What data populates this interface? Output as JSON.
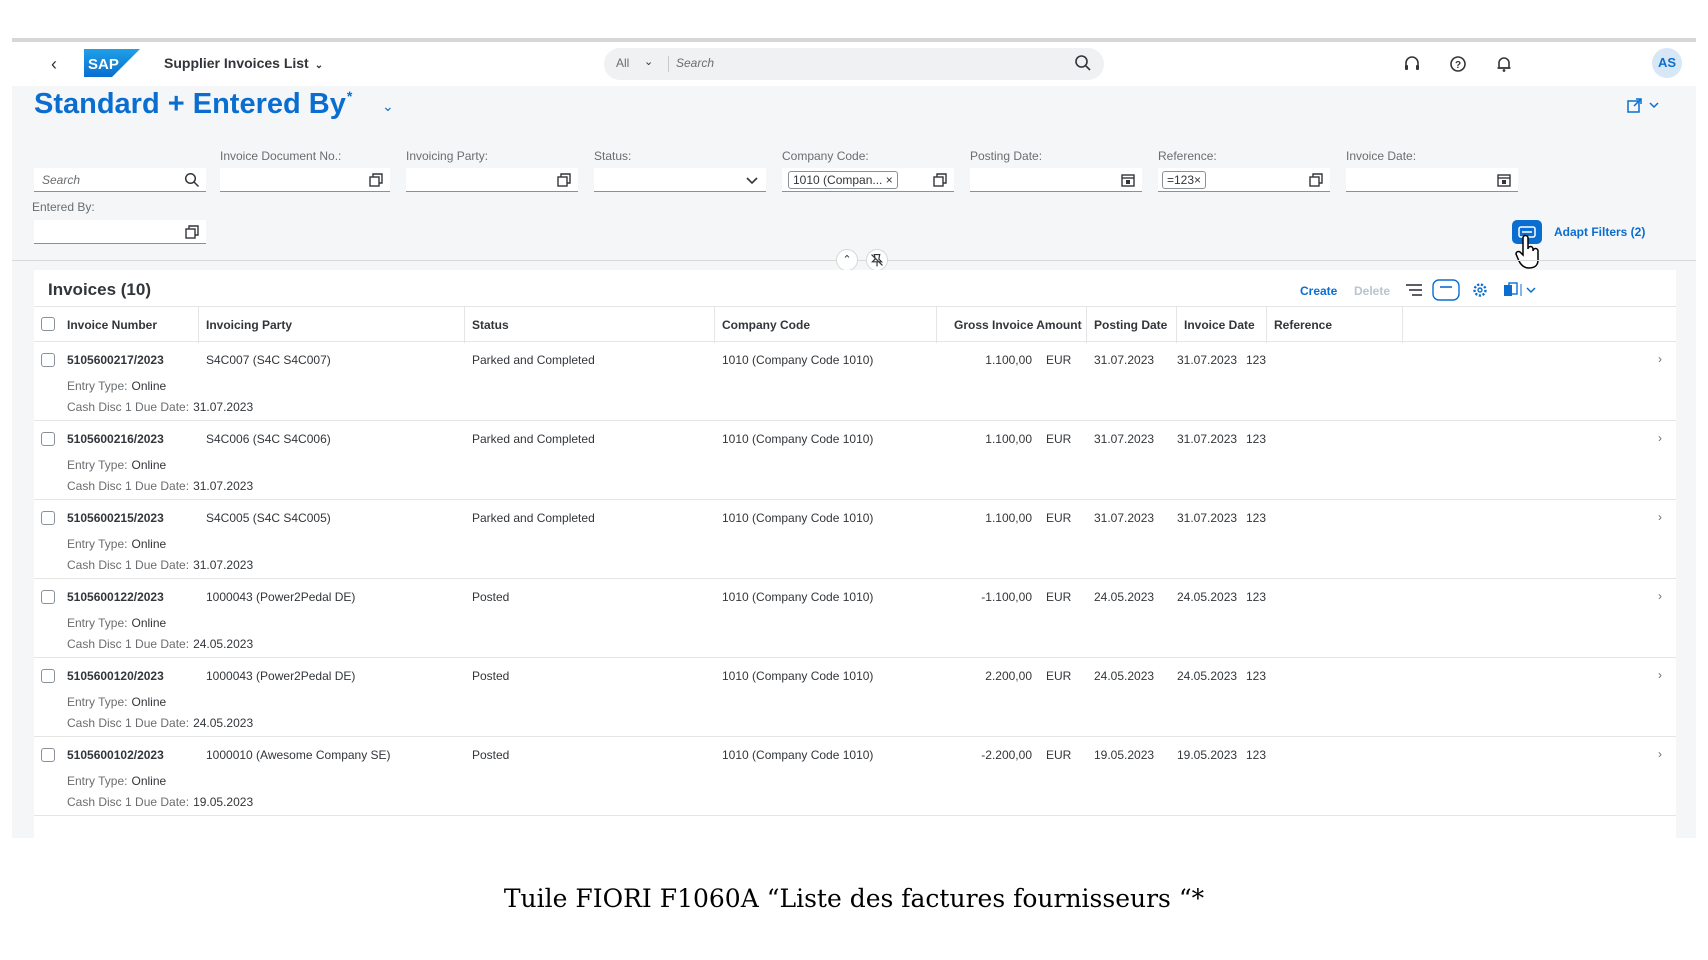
{
  "shell": {
    "app_title": "Supplier Invoices List",
    "search_scope": "All",
    "search_placeholder": "Search",
    "avatar_initials": "AS"
  },
  "header": {
    "variant_name": "Standard + Entered By",
    "variant_modified_marker": "*"
  },
  "filters": {
    "search_placeholder": "Search",
    "invoice_doc_label": "Invoice Document No.:",
    "invoicing_party_label": "Invoicing Party:",
    "status_label": "Status:",
    "company_code_label": "Company Code:",
    "company_code_token": "1010 (Compan...",
    "posting_date_label": "Posting Date:",
    "reference_label": "Reference:",
    "reference_token": "=123",
    "invoice_date_label": "Invoice Date:",
    "entered_by_label": "Entered By:",
    "adapt_filters_label": "Adapt Filters (2)"
  },
  "table": {
    "title": "Invoices (10)",
    "create_label": "Create",
    "delete_label": "Delete",
    "columns": {
      "invoice_number": "Invoice Number",
      "invoicing_party": "Invoicing Party",
      "status": "Status",
      "company_code": "Company Code",
      "gross_amount": "Gross Invoice Amount",
      "posting_date": "Posting Date",
      "invoice_date": "Invoice Date",
      "reference": "Reference"
    },
    "entry_type_label": "Entry Type:",
    "cash_disc_label": "Cash Disc 1 Due Date:",
    "rows": [
      {
        "invoice": "5105600217/2023",
        "party": "S4C007 (S4C S4C007)",
        "status": "Parked and Completed",
        "company": "1010 (Company Code 1010)",
        "amount": "1.100,00",
        "currency": "EUR",
        "posting": "31.07.2023",
        "invoice_date": "31.07.2023",
        "reference": "123",
        "entry_type": "Online",
        "cash_disc": "31.07.2023"
      },
      {
        "invoice": "5105600216/2023",
        "party": "S4C006 (S4C S4C006)",
        "status": "Parked and Completed",
        "company": "1010 (Company Code 1010)",
        "amount": "1.100,00",
        "currency": "EUR",
        "posting": "31.07.2023",
        "invoice_date": "31.07.2023",
        "reference": "123",
        "entry_type": "Online",
        "cash_disc": "31.07.2023"
      },
      {
        "invoice": "5105600215/2023",
        "party": "S4C005 (S4C S4C005)",
        "status": "Parked and Completed",
        "company": "1010 (Company Code 1010)",
        "amount": "1.100,00",
        "currency": "EUR",
        "posting": "31.07.2023",
        "invoice_date": "31.07.2023",
        "reference": "123",
        "entry_type": "Online",
        "cash_disc": "31.07.2023"
      },
      {
        "invoice": "5105600122/2023",
        "party": "1000043 (Power2Pedal DE)",
        "status": "Posted",
        "company": "1010 (Company Code 1010)",
        "amount": "-1.100,00",
        "currency": "EUR",
        "posting": "24.05.2023",
        "invoice_date": "24.05.2023",
        "reference": "123",
        "entry_type": "Online",
        "cash_disc": "24.05.2023"
      },
      {
        "invoice": "5105600120/2023",
        "party": "1000043 (Power2Pedal DE)",
        "status": "Posted",
        "company": "1010 (Company Code 1010)",
        "amount": "2.200,00",
        "currency": "EUR",
        "posting": "24.05.2023",
        "invoice_date": "24.05.2023",
        "reference": "123",
        "entry_type": "Online",
        "cash_disc": "24.05.2023"
      },
      {
        "invoice": "5105600102/2023",
        "party": "1000010 (Awesome Company SE)",
        "status": "Posted",
        "company": "1010 (Company Code 1010)",
        "amount": "-2.200,00",
        "currency": "EUR",
        "posting": "19.05.2023",
        "invoice_date": "19.05.2023",
        "reference": "123",
        "entry_type": "Online",
        "cash_disc": "19.05.2023"
      }
    ]
  },
  "caption": "Tuile FIORI  F1060A “Liste des factures fournisseurs “*",
  "colors": {
    "accent": "#0a6ed1",
    "text": "#32363a",
    "muted": "#6a6d70"
  }
}
